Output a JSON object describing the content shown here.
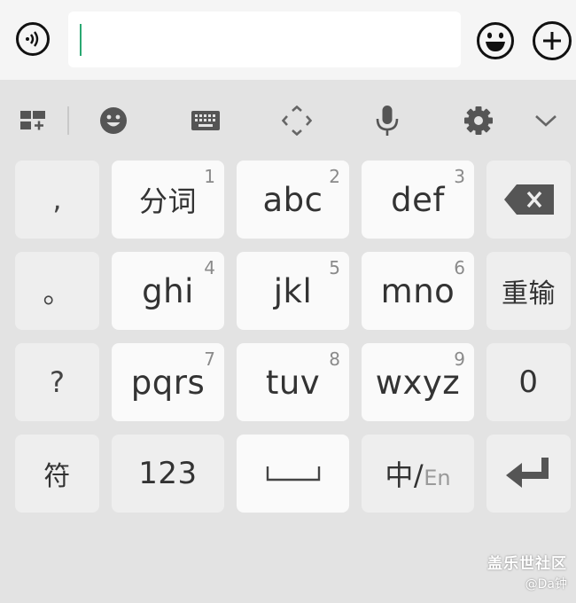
{
  "input": {
    "value": ""
  },
  "toolbar": {
    "items": [
      "menu-grid-icon",
      "emoji-icon",
      "keyboard-icon",
      "move-keyboard-icon",
      "mic-icon",
      "gear-icon",
      "chevron-down-icon"
    ]
  },
  "keys": {
    "comma": ",",
    "period": "。",
    "question": "?",
    "symbol": "符",
    "k1": {
      "label": "分词",
      "num": "1"
    },
    "k2": {
      "label": "abc",
      "num": "2"
    },
    "k3": {
      "label": "def",
      "num": "3"
    },
    "k4": {
      "label": "ghi",
      "num": "4"
    },
    "k5": {
      "label": "jkl",
      "num": "5"
    },
    "k6": {
      "label": "mno",
      "num": "6"
    },
    "k7": {
      "label": "pqrs",
      "num": "7"
    },
    "k8": {
      "label": "tuv",
      "num": "8"
    },
    "k9": {
      "label": "wxyz",
      "num": "9"
    },
    "retype": "重输",
    "zero": "0",
    "num123": "123",
    "lang_cn": "中/",
    "lang_en": "En"
  },
  "watermark": {
    "line1": "盖乐世社区",
    "line2": "@Da钟"
  }
}
